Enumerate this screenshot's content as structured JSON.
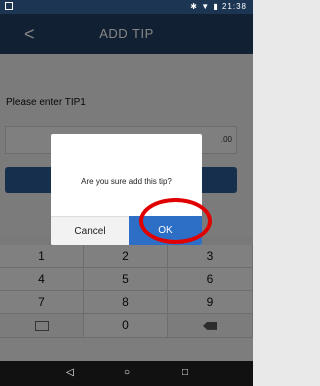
{
  "status_bar": {
    "time": "21:38",
    "icons": "✱ ▼ ▮"
  },
  "header": {
    "back_symbol": "<",
    "title": "ADD TIP"
  },
  "form": {
    "prompt": "Please enter TIP1",
    "amount_suffix": ".00"
  },
  "dialog": {
    "message": "Are you sure add this tip?",
    "cancel": "Cancel",
    "ok": "OK"
  },
  "keypad": {
    "keys": [
      "1",
      "2",
      "3",
      "4",
      "5",
      "6",
      "7",
      "8",
      "9"
    ],
    "zero": "0"
  },
  "nav": {
    "back": "◁",
    "home": "○",
    "recent": "□"
  },
  "colors": {
    "appbar": "#213e63",
    "primary": "#2d6fc7",
    "highlight": "#e00000"
  }
}
